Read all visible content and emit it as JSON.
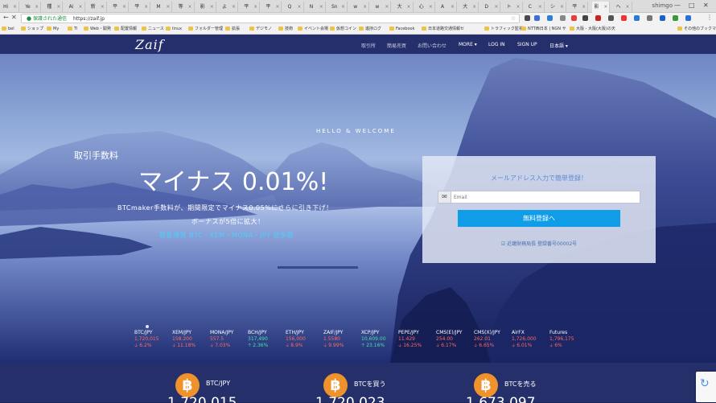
{
  "browser": {
    "tabs": [
      {
        "label": "Hi"
      },
      {
        "label": "Ye"
      },
      {
        "label": "種"
      },
      {
        "label": "Ai"
      },
      {
        "label": "新"
      },
      {
        "label": "平"
      },
      {
        "label": "平"
      },
      {
        "label": "M"
      },
      {
        "label": "等"
      },
      {
        "label": "影"
      },
      {
        "label": "よ"
      },
      {
        "label": "平"
      },
      {
        "label": "平"
      },
      {
        "label": "Q"
      },
      {
        "label": "N"
      },
      {
        "label": "Sn"
      },
      {
        "label": "w"
      },
      {
        "label": "w"
      },
      {
        "label": "大"
      },
      {
        "label": "心"
      },
      {
        "label": "A"
      },
      {
        "label": "大"
      },
      {
        "label": "D"
      },
      {
        "label": "ト"
      },
      {
        "label": "C"
      },
      {
        "label": "シ"
      },
      {
        "label": "平"
      },
      {
        "label": "影"
      },
      {
        "label": "へ"
      }
    ],
    "user": "shimgo",
    "secure_label": "保護された通信",
    "url": "https://zaif.jp",
    "bookmarks": [
      {
        "label": "bel"
      },
      {
        "label": "ショップ"
      },
      {
        "label": "My"
      },
      {
        "label": "Tl"
      },
      {
        "label": "Web・開発"
      },
      {
        "label": "配置情報"
      },
      {
        "label": "ニュース"
      },
      {
        "label": "linux"
      },
      {
        "label": "フォルダー管理"
      },
      {
        "label": "拡張"
      },
      {
        "label": "デジモノ"
      },
      {
        "label": "技術"
      },
      {
        "label": "イベント会場"
      },
      {
        "label": "仮想コイン"
      },
      {
        "label": "進捗ログ"
      },
      {
        "label": "Facebook"
      },
      {
        "label": "日本道路交通情報セ"
      },
      {
        "label": "トラフィック監視"
      },
      {
        "label": "NTT西日本 | NGN サ"
      },
      {
        "label": "大阪 - 大阪(大阪)の天"
      },
      {
        "label": "その他のブックマ"
      }
    ]
  },
  "site": {
    "logo": "Zaif",
    "nav": [
      "取引所",
      "簡易売買",
      "お問い合わせ",
      "MORE ▾",
      "LOG IN",
      "SIGN UP",
      "日本語 ▾"
    ]
  },
  "hero": {
    "welcome": "HELLO & WELCOME",
    "fee_label": "取引手数料",
    "fee_value": "マイナス 0.01%!",
    "promo_line1": "BTCmaker手数料が、期間限定でマイナス0.05%にさらに引き下げ！",
    "promo_line2": "ボーナスが5倍に拡大！",
    "promo_line3": "取扱通貨 BTC・XEM・MONA・JPY 他多数"
  },
  "signup": {
    "title": "メールアドレス入力で簡単登録！",
    "email_placeholder": "Email",
    "button": "無料登録へ",
    "license": "☑ 近畿財務局長 登録番号00002号"
  },
  "tickers": [
    {
      "pair": "BTC/JPY",
      "price": "1,720,015",
      "change": "🡣 6.2%",
      "up": false
    },
    {
      "pair": "XEM/JPY",
      "price": "158.200",
      "change": "🡣 11.18%",
      "up": false
    },
    {
      "pair": "MONA/JPY",
      "price": "557.5",
      "change": "🡣 7.03%",
      "up": false
    },
    {
      "pair": "BCH/JPY",
      "price": "317,490",
      "change": "🡡 2.36%",
      "up": true
    },
    {
      "pair": "ETH/JPY",
      "price": "156,000",
      "change": "🡣 8.9%",
      "up": false
    },
    {
      "pair": "ZAIF/JPY",
      "price": "1.5580",
      "change": "🡣 9.99%",
      "up": false
    },
    {
      "pair": "XCP/JPY",
      "price": "10,609.00",
      "change": "🡡 23.16%",
      "up": true
    },
    {
      "pair": "PEPE/JPY",
      "price": "11.429",
      "change": "🡣 16.25%",
      "up": false
    },
    {
      "pair": "CMS(E)/JPY",
      "price": "254.00",
      "change": "🡣 6.17%",
      "up": false
    },
    {
      "pair": "CMS(X)/JPY",
      "price": "262.01",
      "change": "🡣 6.65%",
      "up": false
    },
    {
      "pair": "AirFX",
      "price": "1,726,000",
      "change": "🡣 6.01%",
      "up": false
    },
    {
      "pair": "Futures",
      "price": "1,796,175",
      "change": "🡣 6%",
      "up": false
    }
  ],
  "bottom": [
    {
      "icon": "฿",
      "label": "BTC/JPY",
      "value": "1,720,015"
    },
    {
      "icon": "฿",
      "label": "BTCを買う",
      "value": "1,720,023"
    },
    {
      "icon": "฿",
      "label": "BTCを売る",
      "value": "1,673,097"
    }
  ]
}
